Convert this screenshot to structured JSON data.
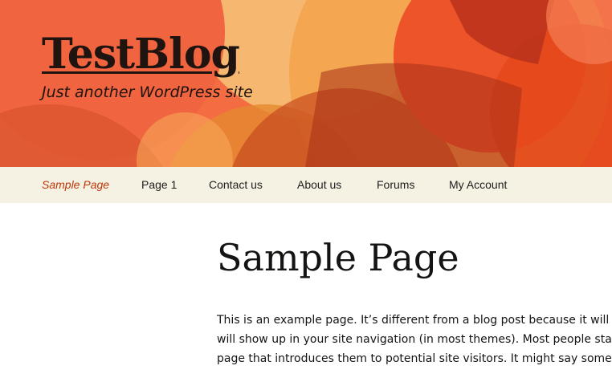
{
  "site": {
    "title": "TestBlog",
    "description": "Just another WordPress site"
  },
  "nav": {
    "items": [
      {
        "label": "Sample Page",
        "current": true
      },
      {
        "label": "Page 1"
      },
      {
        "label": "Contact us"
      },
      {
        "label": "About us"
      },
      {
        "label": "Forums"
      },
      {
        "label": "My Account"
      }
    ]
  },
  "page": {
    "title": "Sample Page",
    "content_lines": [
      "This is an example page. It’s different from a blog post because it will stay i",
      "will show up in your site navigation (in most themes). Most people start wi",
      "page that introduces them to potential site visitors. It might say something"
    ]
  },
  "colors": {
    "header_base": "#f46c42",
    "nav_background": "#f5f2e3",
    "nav_current": "#bc360a",
    "title_text": "#141412"
  }
}
